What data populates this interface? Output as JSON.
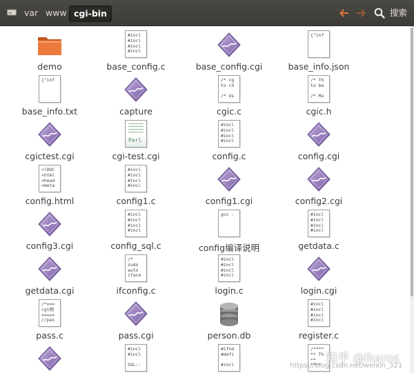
{
  "toolbar": {
    "breadcrumbs": [
      {
        "label": "var"
      },
      {
        "label": "www"
      },
      {
        "label": "cgi-bin"
      }
    ],
    "search_label": "搜索",
    "icons": [
      "drive-icon",
      "back-arrow-icon",
      "forward-arrow-icon",
      "search-icon"
    ],
    "accent_color": "#e2763a"
  },
  "files": [
    {
      "name": "demo",
      "icon": "folder"
    },
    {
      "name": "base_config.c",
      "icon": "text",
      "preview": [
        "#incl",
        "#incl",
        "#incl",
        "#incl"
      ]
    },
    {
      "name": "base_config.cgi",
      "icon": "exec"
    },
    {
      "name": "base_info.json",
      "icon": "text",
      "preview": [
        "{\"inf"
      ]
    },
    {
      "name": "base_info.txt",
      "icon": "text",
      "preview": [
        "{\"inf"
      ]
    },
    {
      "name": "capture",
      "icon": "exec"
    },
    {
      "name": "cgic.c",
      "icon": "text",
      "preview": [
        "/* cg",
        "to ch",
        "",
        "/* Us"
      ]
    },
    {
      "name": "cgic.h",
      "icon": "text",
      "preview": [
        "/* Th",
        "to be",
        "",
        "/* Ma"
      ]
    },
    {
      "name": "cgictest.cgi",
      "icon": "exec"
    },
    {
      "name": "cgi-test.cgi",
      "icon": "perl",
      "preview": [
        "Perl"
      ]
    },
    {
      "name": "config.c",
      "icon": "text",
      "preview": [
        "#incl",
        "#incl",
        "#incl",
        "#incl"
      ]
    },
    {
      "name": "config.cgi",
      "icon": "exec"
    },
    {
      "name": "config.html",
      "icon": "text",
      "preview": [
        "<!DOC",
        "<html",
        "<head",
        "<meta"
      ]
    },
    {
      "name": "config1.c",
      "icon": "text",
      "preview": [
        "#incl",
        "#incl",
        "#incl",
        "#incl"
      ]
    },
    {
      "name": "config1.cgi",
      "icon": "exec"
    },
    {
      "name": "config2.cgi",
      "icon": "exec"
    },
    {
      "name": "config3.cgi",
      "icon": "exec"
    },
    {
      "name": "config_sql.c",
      "icon": "text",
      "preview": [
        "#incl",
        "#incl",
        "#incl",
        "#incl"
      ]
    },
    {
      "name": "config编译说明",
      "icon": "text",
      "preview": [
        "gcc -"
      ]
    },
    {
      "name": "getdata.c",
      "icon": "text",
      "preview": [
        "#incl",
        "#incl",
        "#incl",
        "#incl"
      ]
    },
    {
      "name": "getdata.cgi",
      "icon": "exec"
    },
    {
      "name": "ifconfig.c",
      "icon": "text",
      "preview": [
        "/*",
        "sudo",
        "auto",
        "iface"
      ]
    },
    {
      "name": "login.c",
      "icon": "text",
      "preview": [
        "#incl",
        "#incl",
        "#incl",
        "#incl"
      ]
    },
    {
      "name": "login.cgi",
      "icon": "exec"
    },
    {
      "name": "pass.c",
      "icon": "text",
      "preview": [
        "/*===",
        "cgi例",
        "=====",
        "//pas"
      ]
    },
    {
      "name": "pass.cgi",
      "icon": "exec"
    },
    {
      "name": "person.db",
      "icon": "db"
    },
    {
      "name": "register.c",
      "icon": "text",
      "preview": [
        "#incl",
        "#incl",
        "#incl",
        "#incl"
      ]
    },
    {
      "name": "",
      "icon": "exec"
    },
    {
      "name": "",
      "icon": "text",
      "preview": [
        "#incl",
        "#incl",
        "",
        "SOL::"
      ]
    },
    {
      "name": "",
      "icon": "text",
      "preview": [
        "#ifnd",
        "#defi",
        "",
        "#incl"
      ]
    },
    {
      "name": "",
      "icon": "text",
      "preview": [
        "/****",
        "** Th",
        "** ",
        "****"
      ]
    }
  ],
  "watermark": {
    "main": "知乎 @lkaros",
    "sub": "https://blog.csdn.net/weixin_321"
  }
}
